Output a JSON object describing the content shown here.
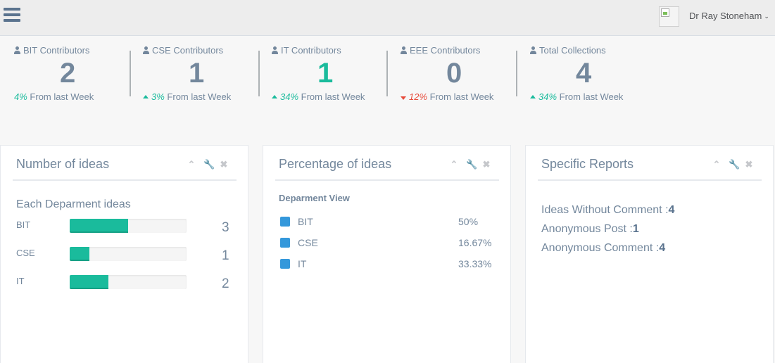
{
  "header": {
    "menu_icon": "hamburger-menu-icon",
    "user_name": "Dr Ray Stoneham",
    "caret_icon": "chevron-down-icon"
  },
  "tiles": [
    {
      "label": "BIT Contributors",
      "count": "2",
      "change_pct": "4%",
      "change_text": "From last Week",
      "direction": "none"
    },
    {
      "label": "CSE Contributors",
      "count": "1",
      "change_pct": "3%",
      "change_text": "From last Week",
      "direction": "up"
    },
    {
      "label": "IT Contributors",
      "count": "1",
      "change_pct": "34%",
      "change_text": "From last Week",
      "direction": "up"
    },
    {
      "label": "EEE Contributors",
      "count": "0",
      "change_pct": "12%",
      "change_text": "From last Week",
      "direction": "down"
    },
    {
      "label": "Total Collections",
      "count": "4",
      "change_pct": "34%",
      "change_text": "From last Week",
      "direction": "up"
    }
  ],
  "panels": {
    "ideas": {
      "title": "Number of ideas",
      "subtitle": "Each Deparment ideas",
      "rows": [
        {
          "name": "BIT",
          "value": "3",
          "fill_fraction": 0.5
        },
        {
          "name": "CSE",
          "value": "1",
          "fill_fraction": 0.17
        },
        {
          "name": "IT",
          "value": "2",
          "fill_fraction": 0.33
        }
      ]
    },
    "percentage": {
      "title": "Percentage of ideas",
      "subtitle": "Deparment View",
      "rows": [
        {
          "name": "BIT",
          "pct": "50%"
        },
        {
          "name": "CSE",
          "pct": "16.67%"
        },
        {
          "name": "IT",
          "pct": "33.33%"
        }
      ]
    },
    "reports": {
      "title": "Specific Reports",
      "rows": [
        {
          "label": "Ideas Without Comment :",
          "value": "4"
        },
        {
          "label": "Anonymous Post :",
          "value": "1"
        },
        {
          "label": "Anonymous Comment :",
          "value": "4"
        }
      ]
    }
  },
  "colors": {
    "accent": "#1abb9c",
    "negative": "#e74c3c",
    "legend": "#3498db",
    "text": "#73879c"
  }
}
